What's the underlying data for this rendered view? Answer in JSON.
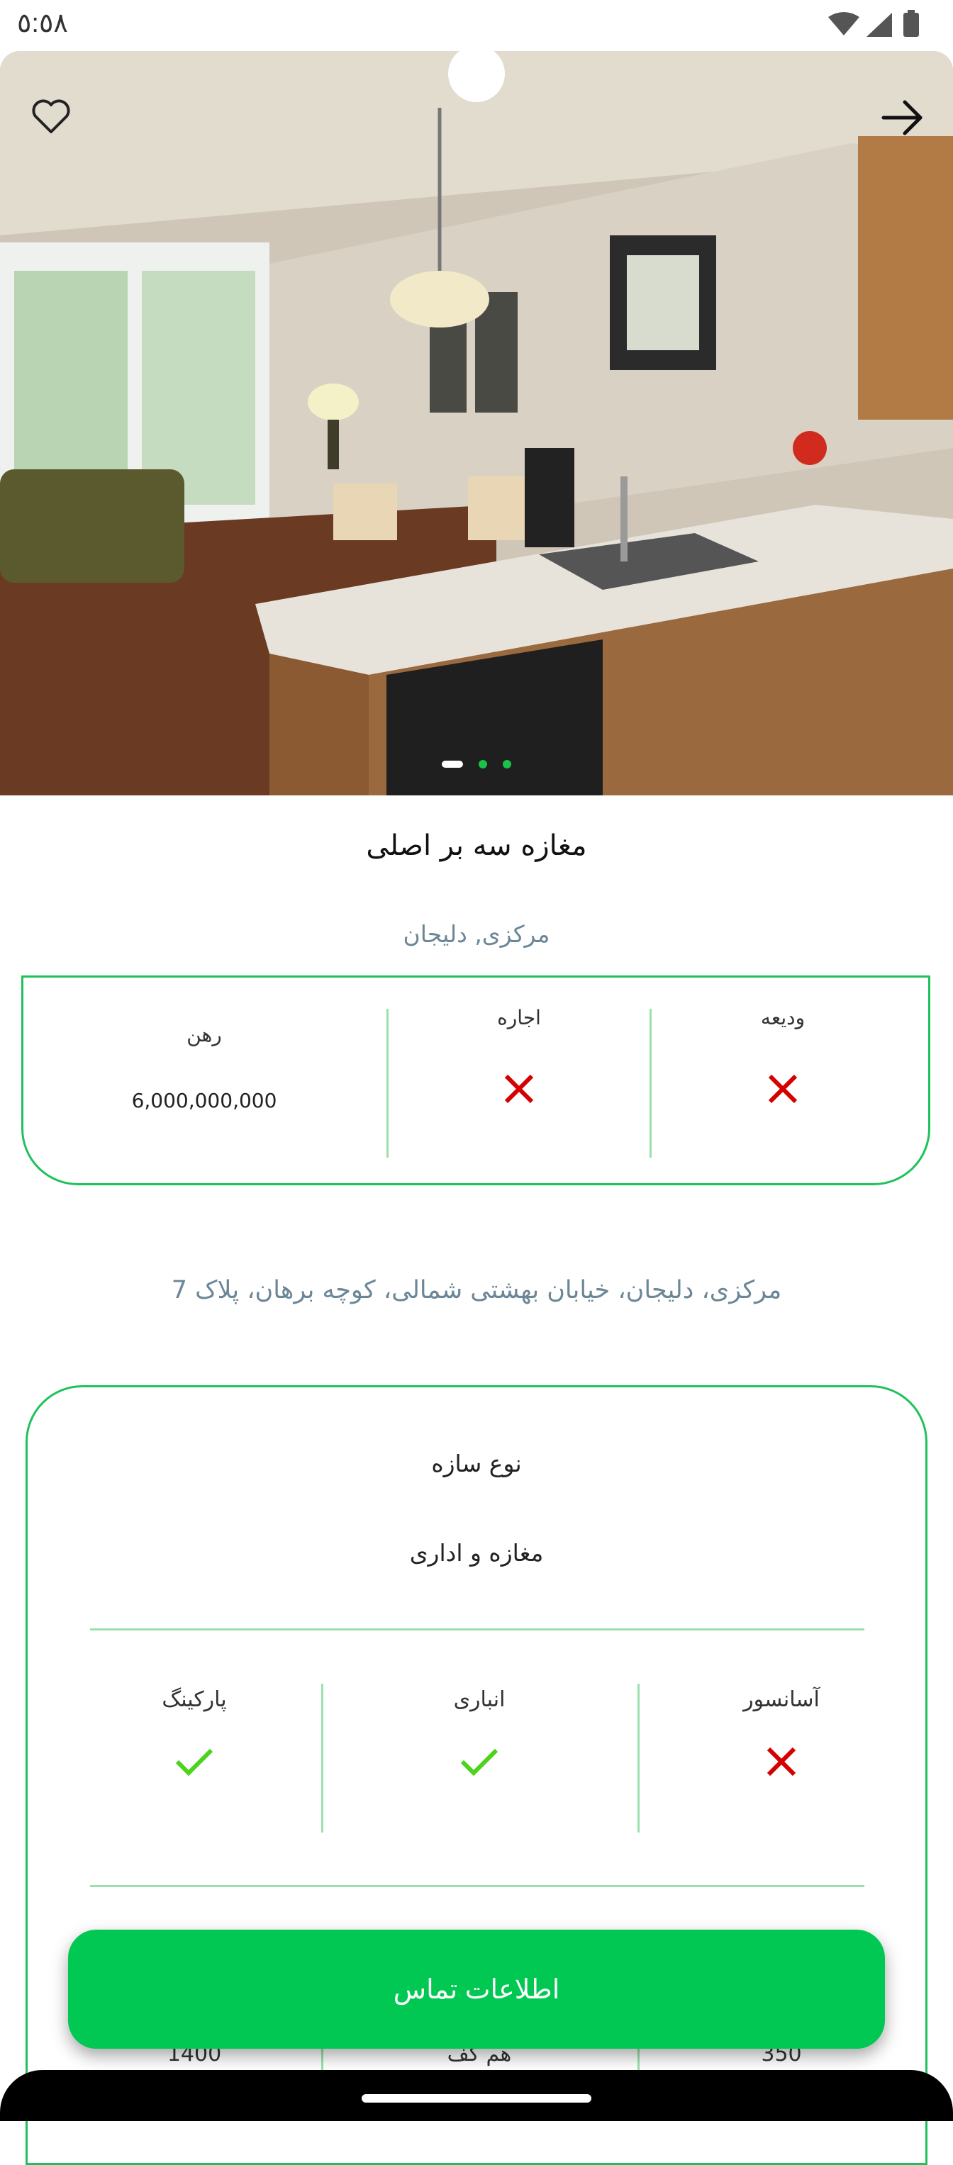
{
  "status_bar": {
    "time": "٥:٥٨"
  },
  "gallery": {
    "image_count": 3,
    "active_index": 0
  },
  "listing": {
    "title": "مغازه سه بر اصلی",
    "location": "مرکزی, دلیجان",
    "address": "مرکزی، دلیجان، خیابان بهشتی شمالی، کوچه برهان، پلاک 7"
  },
  "prices": {
    "deposit_label": "ودیعه",
    "deposit_available": false,
    "rent_label": "اجاره",
    "rent_available": false,
    "mortgage_label": "رهن",
    "mortgage_value": "6,000,000,000"
  },
  "details": {
    "structure_label": "نوع سازه",
    "structure_value": "مغازه و اداری",
    "features": [
      {
        "label": "آسانسور",
        "available": false
      },
      {
        "label": "انباری",
        "available": true
      },
      {
        "label": "پارکینگ",
        "available": true
      }
    ],
    "bottom_values": [
      "350",
      "هم کف",
      "1400"
    ]
  },
  "actions": {
    "contact_label": "اطلاعات تماس"
  },
  "colors": {
    "accent": "#00c853",
    "border": "#1fc25a",
    "muted": "#6b8797",
    "no": "#d50000",
    "yes": "#4cd31c"
  },
  "icons": {
    "favorite": "heart-outline-icon",
    "back": "arrow-right-icon",
    "no": "close-icon",
    "yes": "check-icon"
  }
}
